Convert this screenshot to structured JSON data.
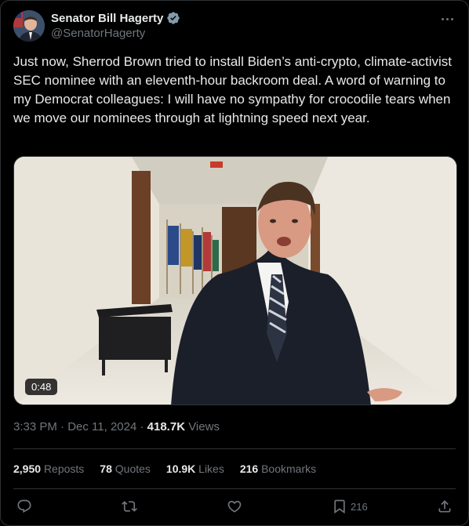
{
  "author": {
    "display_name": "Senator Bill Hagerty",
    "handle": "@SenatorHagerty",
    "verified_color": "#829aab"
  },
  "tweet": {
    "text": "Just now, Sherrod Brown tried to install Biden’s anti-crypto, climate-activist SEC nominee with an eleventh-hour backroom deal. A word of warning to my Democrat colleagues: I will have no sympathy for crocodile tears when we move our nominees through at lightning speed next year."
  },
  "media": {
    "duration": "0:48"
  },
  "meta": {
    "timestamp": "3:33 PM · Dec 11, 2024",
    "separator": " · ",
    "views_count": "418.7K",
    "views_label": "Views"
  },
  "stats": {
    "reposts_count": "2,950",
    "reposts_label": "Reposts",
    "quotes_count": "78",
    "quotes_label": "Quotes",
    "likes_count": "10.9K",
    "likes_label": "Likes",
    "bookmarks_count": "216",
    "bookmarks_label": "Bookmarks"
  },
  "actions": {
    "bookmark_count": "216",
    "icons": [
      "reply-icon",
      "repost-icon",
      "like-icon",
      "bookmark-icon",
      "share-icon"
    ]
  }
}
